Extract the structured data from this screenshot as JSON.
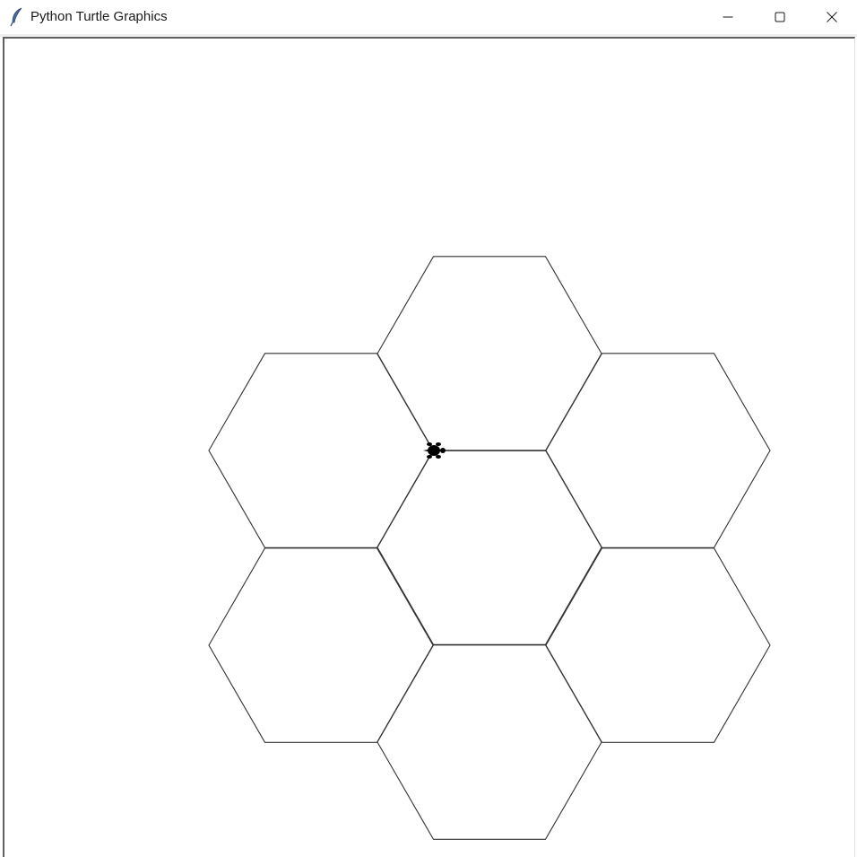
{
  "window": {
    "title": "Python Turtle Graphics",
    "icons": {
      "app": "feather-icon",
      "minimize": "minimize-icon",
      "maximize": "maximize-icon",
      "close": "close-icon"
    }
  },
  "drawing": {
    "stroke_color": "#333333",
    "turtle_color": "#000000",
    "hexagon_count": 7
  }
}
